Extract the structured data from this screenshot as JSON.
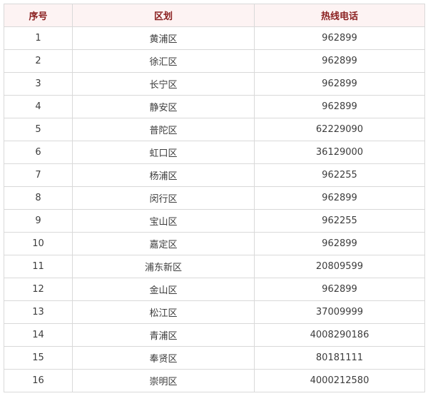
{
  "table": {
    "headers": {
      "index": "序号",
      "district": "区划",
      "phone": "热线电话"
    },
    "rows": [
      {
        "index": "1",
        "district": "黄浦区",
        "phone": "962899"
      },
      {
        "index": "2",
        "district": "徐汇区",
        "phone": "962899"
      },
      {
        "index": "3",
        "district": "长宁区",
        "phone": "962899"
      },
      {
        "index": "4",
        "district": "静安区",
        "phone": "962899"
      },
      {
        "index": "5",
        "district": "普陀区",
        "phone": "62229090"
      },
      {
        "index": "6",
        "district": "虹口区",
        "phone": "36129000"
      },
      {
        "index": "7",
        "district": "杨浦区",
        "phone": "962255"
      },
      {
        "index": "8",
        "district": "闵行区",
        "phone": "962899"
      },
      {
        "index": "9",
        "district": "宝山区",
        "phone": "962255"
      },
      {
        "index": "10",
        "district": "嘉定区",
        "phone": "962899"
      },
      {
        "index": "11",
        "district": "浦东新区",
        "phone": "20809599"
      },
      {
        "index": "12",
        "district": "金山区",
        "phone": "962899"
      },
      {
        "index": "13",
        "district": "松江区",
        "phone": "37009999"
      },
      {
        "index": "14",
        "district": "青浦区",
        "phone": "4008290186"
      },
      {
        "index": "15",
        "district": "奉贤区",
        "phone": "80181111"
      },
      {
        "index": "16",
        "district": "崇明区",
        "phone": "4000212580"
      }
    ]
  },
  "colors": {
    "header_background": "#fdf3f3",
    "header_text": "#8a1f1f",
    "cell_text": "#3c3c3c",
    "border": "#d9d9d9"
  }
}
